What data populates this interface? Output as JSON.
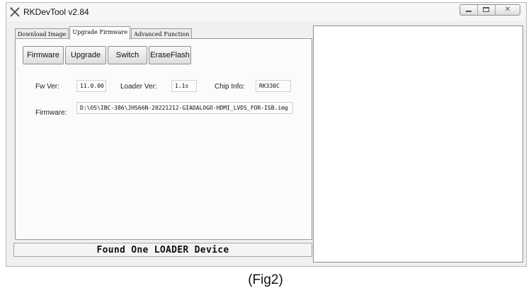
{
  "window": {
    "title": "RKDevTool v2.84"
  },
  "tabs": [
    {
      "label": "Download Image",
      "active": false
    },
    {
      "label": "Upgrade Firmware",
      "active": true
    },
    {
      "label": "Advanced Function",
      "active": false
    }
  ],
  "buttons": {
    "firmware": "Firmware",
    "upgrade": "Upgrade",
    "switch": "Switch",
    "eraseflash": "EraseFlash"
  },
  "info": {
    "fw_ver_label": "Fw Ver:",
    "fw_ver_value": "11.0.00",
    "loader_ver_label": "Loader Ver:",
    "loader_ver_value": "1.1s",
    "chip_info_label": "Chip Info:",
    "chip_info_value": "RK330C",
    "firmware_label": "Firmware:",
    "firmware_path": "D:\\OS\\IBC-386\\JHS66N-20221212-GIADALOGO-HDMI_LVDS_FOR-ISB.img"
  },
  "status": {
    "message": "Found One LOADER Device"
  },
  "caption": "(Fig2)"
}
